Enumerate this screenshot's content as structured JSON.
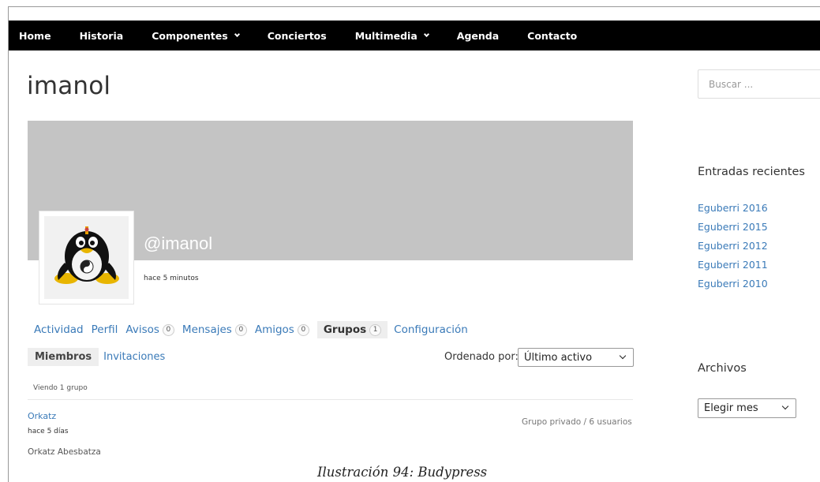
{
  "nav": {
    "items": [
      {
        "label": "Home",
        "dropdown": false
      },
      {
        "label": "Historia",
        "dropdown": false
      },
      {
        "label": "Componentes",
        "dropdown": true
      },
      {
        "label": "Conciertos",
        "dropdown": false
      },
      {
        "label": "Multimedia",
        "dropdown": true
      },
      {
        "label": "Agenda",
        "dropdown": false
      },
      {
        "label": "Contacto",
        "dropdown": false
      }
    ]
  },
  "profile": {
    "title": "imanol",
    "handle": "@imanol",
    "last_active": "hace 5 minutos",
    "avatar_icon": "tux-penguin-avatar"
  },
  "tabs": [
    {
      "label": "Actividad",
      "count": null,
      "active": false
    },
    {
      "label": "Perfil",
      "count": null,
      "active": false
    },
    {
      "label": "Avisos",
      "count": "0",
      "active": false
    },
    {
      "label": "Mensajes",
      "count": "0",
      "active": false
    },
    {
      "label": "Amigos",
      "count": "0",
      "active": false
    },
    {
      "label": "Grupos",
      "count": "1",
      "active": true
    },
    {
      "label": "Configuración",
      "count": null,
      "active": false
    }
  ],
  "subtabs": [
    {
      "label": "Miembros",
      "active": true
    },
    {
      "label": "Invitaciones",
      "active": false
    }
  ],
  "order": {
    "label": "Ordenado por:",
    "selected": "Último activo"
  },
  "list": {
    "viewing": "Viendo 1 grupo",
    "groups": [
      {
        "name": "Orkatz",
        "active": "hace 5 días",
        "meta": "Grupo privado / 6 usuarios",
        "description": "Orkatz Abesbatza"
      }
    ]
  },
  "sidebar": {
    "search_placeholder": "Buscar ...",
    "recent_title": "Entradas recientes",
    "recent_posts": [
      "Eguberri 2016",
      "Eguberri 2015",
      "Eguberri 2012",
      "Eguberri 2011",
      "Eguberri 2010"
    ],
    "archives_title": "Archivos",
    "archives_selected": "Elegir mes"
  },
  "caption": "Ilustración 94: Budypress",
  "colors": {
    "navbar": "#000000",
    "link": "#3a7ab8",
    "cover": "#c4c4c4"
  }
}
